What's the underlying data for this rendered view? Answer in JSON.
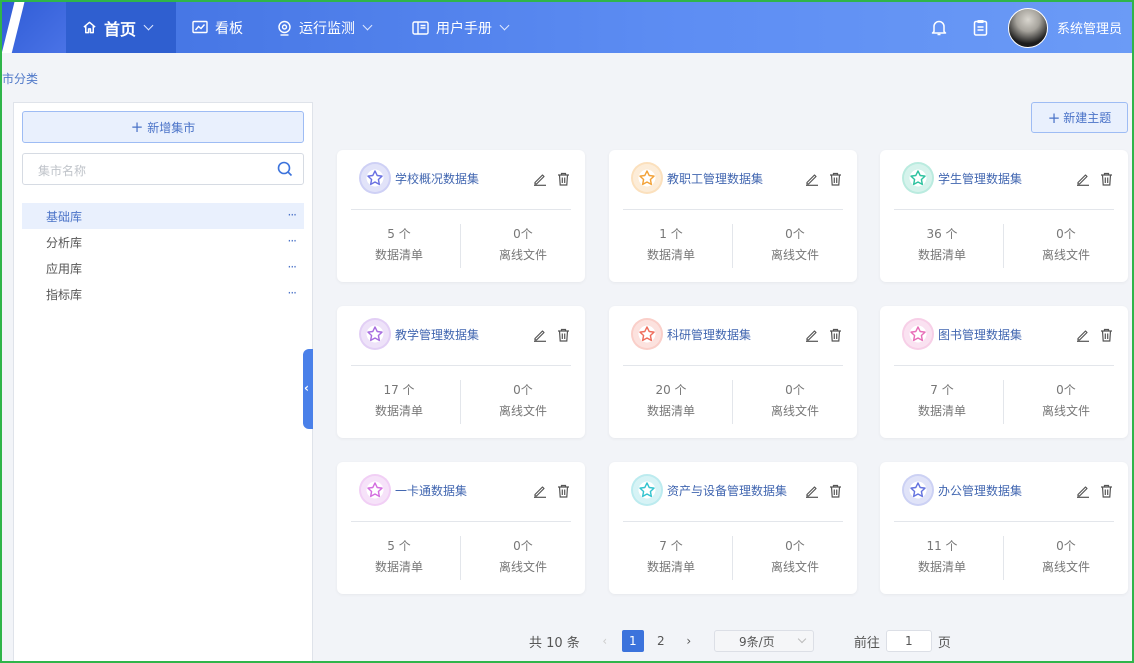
{
  "nav": {
    "items": [
      {
        "label": "首页",
        "icon": "home-icon"
      },
      {
        "label": "看板",
        "icon": "chart-icon"
      },
      {
        "label": "运行监测",
        "icon": "monitor-icon"
      },
      {
        "label": "用户手册",
        "icon": "book-icon"
      }
    ],
    "user_name": "系统管理员"
  },
  "breadcrumb": "市分类",
  "sidebar": {
    "add_button": "新增集市",
    "search_placeholder": "集市名称",
    "items": [
      {
        "label": "基础库",
        "more": "···"
      },
      {
        "label": "分析库",
        "more": "···"
      },
      {
        "label": "应用库",
        "more": "···"
      },
      {
        "label": "指标库",
        "more": "···"
      }
    ]
  },
  "toolbar": {
    "new_theme": "新建主题"
  },
  "cards": [
    {
      "title": "学校概况数据集",
      "count": "5 个",
      "count_label": "数据清单",
      "files": "0个",
      "files_label": "离线文件",
      "color": "#6b72e2"
    },
    {
      "title": "教职工管理数据集",
      "count": "1 个",
      "count_label": "数据清单",
      "files": "0个",
      "files_label": "离线文件",
      "color": "#f3a33a"
    },
    {
      "title": "学生管理数据集",
      "count": "36 个",
      "count_label": "数据清单",
      "files": "0个",
      "files_label": "离线文件",
      "color": "#2fc3a0"
    },
    {
      "title": "教学管理数据集",
      "count": "17 个",
      "count_label": "数据清单",
      "files": "0个",
      "files_label": "离线文件",
      "color": "#a86ee0"
    },
    {
      "title": "科研管理数据集",
      "count": "20 个",
      "count_label": "数据清单",
      "files": "0个",
      "files_label": "离线文件",
      "color": "#ef6e5d"
    },
    {
      "title": "图书管理数据集",
      "count": "7 个",
      "count_label": "数据清单",
      "files": "0个",
      "files_label": "离线文件",
      "color": "#e86fb8"
    },
    {
      "title": "一卡通数据集",
      "count": "5 个",
      "count_label": "数据清单",
      "files": "0个",
      "files_label": "离线文件",
      "color": "#d46fe0"
    },
    {
      "title": "资产与设备管理数据集",
      "count": "7 个",
      "count_label": "数据清单",
      "files": "0个",
      "files_label": "离线文件",
      "color": "#35c4cf"
    },
    {
      "title": "办公管理数据集",
      "count": "11 个",
      "count_label": "数据清单",
      "files": "0个",
      "files_label": "离线文件",
      "color": "#6574df"
    }
  ],
  "pagination": {
    "total": "共 10 条",
    "pages": [
      "1",
      "2"
    ],
    "current": "1",
    "page_size": "9条/页",
    "goto_label": "前往",
    "goto_value": "1",
    "page_suffix": "页"
  }
}
